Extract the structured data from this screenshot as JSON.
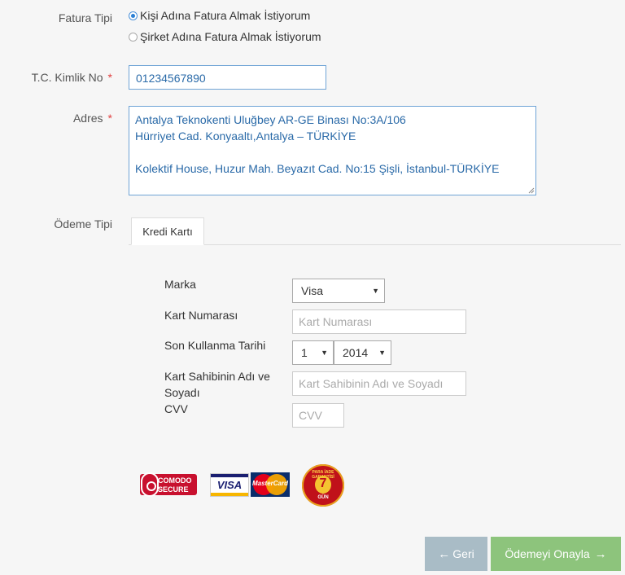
{
  "invoice": {
    "label": "Fatura Tipi",
    "options": [
      "Kişi Adına Fatura Almak İstiyorum",
      "Şirket Adına Fatura Almak İstiyorum"
    ],
    "selected_index": 0
  },
  "tc": {
    "label": "T.C. Kimlik No",
    "required_mark": "*",
    "value": "01234567890"
  },
  "address": {
    "label": "Adres",
    "required_mark": "*",
    "lines": [
      "Antalya Teknokenti Uluğbey AR-GE Binası No:3A/106",
      "Hürriyet Cad. Konyaaltı,Antalya – TÜRKİYE",
      "",
      "Kolektif House, Huzur Mah. Beyazıt Cad. No:15 Şişli, İstanbul-TÜRKİYE"
    ]
  },
  "payment": {
    "label": "Ödeme Tipi",
    "tab": "Kredi Kartı",
    "brand_label": "Marka",
    "brand_value": "Visa",
    "card_number_label": "Kart Numarası",
    "card_number_placeholder": "Kart Numarası",
    "expiry_label": "Son Kullanma Tarihi",
    "expiry_month": "1",
    "expiry_year": "2014",
    "holder_label": "Kart Sahibinin Adı ve Soyadı",
    "holder_placeholder": "Kart Sahibinin Adı ve Soyadı",
    "cvv_label": "CVV",
    "cvv_placeholder": "CVV"
  },
  "badges": {
    "comodo_top": "COMODO",
    "comodo_bottom": "SECURE",
    "visa": "VISA",
    "mastercard": "MasterCard",
    "guarantee_top": "PARA İADE GARANTİSİ",
    "guarantee_number": "7",
    "guarantee_bottom": "GÜN"
  },
  "buttons": {
    "back": "Geri",
    "confirm": "Ödemeyi Onayla"
  },
  "colors": {
    "back_button": "#a9bcc6",
    "confirm_button": "#8dc47c",
    "accent": "#2a7fd4"
  }
}
